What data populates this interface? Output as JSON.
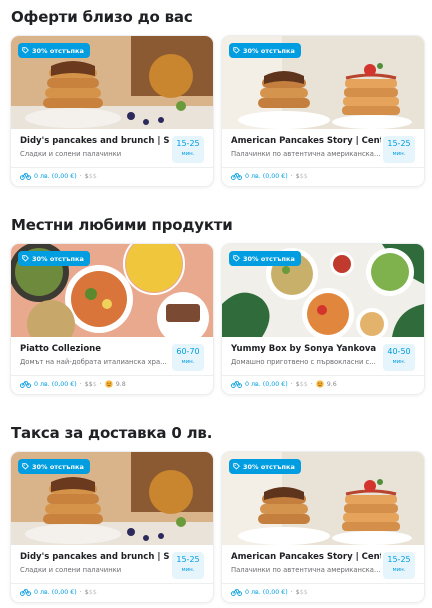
{
  "sections": [
    {
      "title": "Оферти близо до вас",
      "cards": [
        {
          "badge": "30% отстъпка",
          "name": "Didy's pancakes and brunch | Sofia",
          "desc": "Сладки и солени палачинки",
          "eta_value": "15-25",
          "eta_unit": "мин.",
          "fee": "0 лв. (0,00 €)",
          "dot": "·",
          "price_active": "$",
          "price_inactive": "$$",
          "rating": ""
        },
        {
          "badge": "30% отстъпка",
          "name": "American Pancakes Story | Center",
          "desc": "Палачинки по автентична американска...",
          "eta_value": "15-25",
          "eta_unit": "мин.",
          "fee": "0 лв. (0,00 €)",
          "dot": "·",
          "price_active": "$",
          "price_inactive": "$$",
          "rating": ""
        }
      ]
    },
    {
      "title": "Местни любими продукти",
      "cards": [
        {
          "badge": "30% отстъпка",
          "name": "Piatto Collezione",
          "desc": "Домът на най-добрата италианска хра...",
          "eta_value": "60-70",
          "eta_unit": "мин.",
          "fee": "0 лв. (0,00 €)",
          "dot": "·",
          "price_active": "$$",
          "price_inactive": "$",
          "rating": "9.8"
        },
        {
          "badge": "30% отстъпка",
          "name": "Yummy Box by Sonya Yankova",
          "desc": "Домашно приготвено с първокласни с...",
          "eta_value": "40-50",
          "eta_unit": "мин.",
          "fee": "0 лв. (0,00 €)",
          "dot": "·",
          "price_active": "$",
          "price_inactive": "$$",
          "rating": "9.6"
        }
      ]
    },
    {
      "title": "Такса за доставка 0 лв.",
      "cards": [
        {
          "badge": "30% отстъпка",
          "name": "Didy's pancakes and brunch | Sofia",
          "desc": "Сладки и солени палачинки",
          "eta_value": "15-25",
          "eta_unit": "мин.",
          "fee": "0 лв. (0,00 €)",
          "dot": "·",
          "price_active": "$",
          "price_inactive": "$$",
          "rating": ""
        },
        {
          "badge": "30% отстъпка",
          "name": "American Pancakes Story | Center",
          "desc": "Палачинки по автентична американска...",
          "eta_value": "15-25",
          "eta_unit": "мин.",
          "fee": "0 лв. (0,00 €)",
          "dot": "·",
          "price_active": "$",
          "price_inactive": "$$",
          "rating": ""
        }
      ]
    }
  ],
  "colors": {
    "accent": "#009de0",
    "eta_bg": "#e6f4fb",
    "text": "#202125",
    "muted": "#6b6b70"
  }
}
